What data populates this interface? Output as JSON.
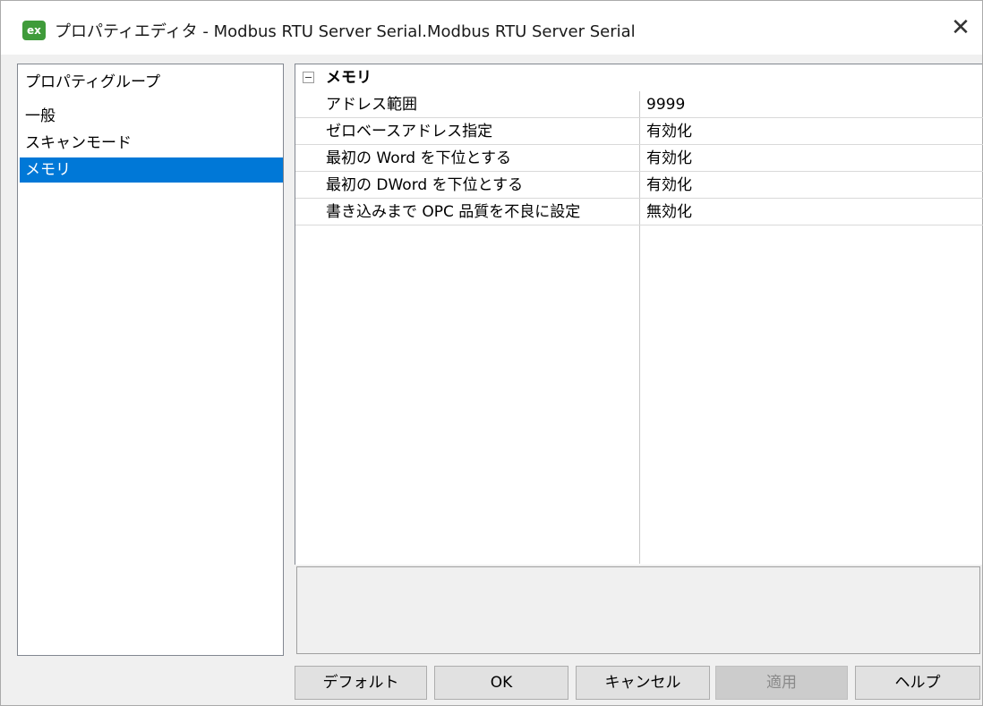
{
  "window": {
    "title": "プロパティエディタ - Modbus RTU Server Serial.Modbus RTU Server Serial",
    "app_icon_text": "ex",
    "close_glyph": "✕"
  },
  "groups": {
    "header": "プロパティグループ",
    "items": [
      {
        "label": "一般",
        "selected": false
      },
      {
        "label": "スキャンモード",
        "selected": false
      },
      {
        "label": "メモリ",
        "selected": true
      }
    ]
  },
  "property_grid": {
    "category": "メモリ",
    "rows": [
      {
        "name": "アドレス範囲",
        "value": "9999"
      },
      {
        "name": "ゼロベースアドレス指定",
        "value": "有効化"
      },
      {
        "name": "最初の Word を下位とする",
        "value": "有効化"
      },
      {
        "name": "最初の DWord を下位とする",
        "value": "有効化"
      },
      {
        "name": "書き込みまで OPC 品質を不良に設定",
        "value": "無効化"
      }
    ]
  },
  "buttons": {
    "default": "デフォルト",
    "ok": "OK",
    "cancel": "キャンセル",
    "apply": "適用",
    "help": "ヘルプ"
  },
  "colors": {
    "selection": "#0078d7",
    "app_icon": "#3f9b3a"
  }
}
